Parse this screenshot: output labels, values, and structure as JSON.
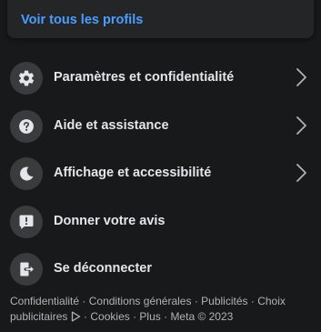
{
  "profiles_card": {
    "see_all_label": "Voir tous les profils"
  },
  "menu": {
    "items": [
      {
        "label": "Paramètres et confidentialité",
        "icon": "gear-icon",
        "has_chevron": true
      },
      {
        "label": "Aide et assistance",
        "icon": "help-icon",
        "has_chevron": true
      },
      {
        "label": "Affichage et accessibilité",
        "icon": "moon-icon",
        "has_chevron": true
      },
      {
        "label": "Donner votre avis",
        "icon": "feedback-icon",
        "has_chevron": false
      },
      {
        "label": "Se déconnecter",
        "icon": "logout-icon",
        "has_chevron": false
      }
    ]
  },
  "footer": {
    "confidentialite": "Confidentialité",
    "conditions": "Conditions générales",
    "publicites": "Publicités",
    "choix_pub": "Choix publicitaires",
    "cookies": "Cookies",
    "plus": "Plus",
    "copyright": "Meta © 2023",
    "separator": " · "
  },
  "colors": {
    "background": "#18191a",
    "card": "#242526",
    "icon_circle": "#3a3b3c",
    "link": "#4a9eff",
    "primary_text": "#e4e6eb",
    "secondary_text": "#b0b3b8"
  }
}
